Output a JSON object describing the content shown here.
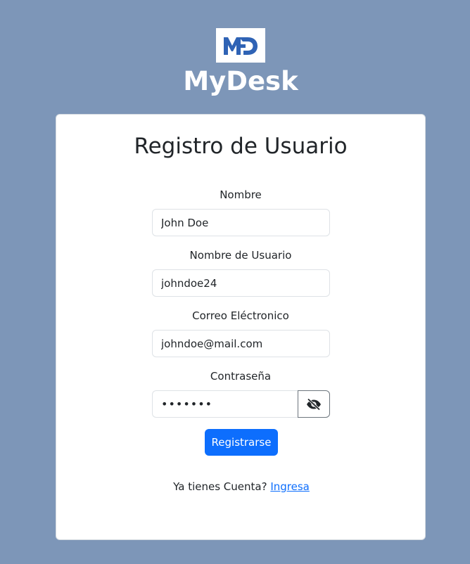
{
  "app": {
    "logo_text": "MD",
    "title": "MyDesk"
  },
  "form": {
    "title": "Registro de Usuario",
    "fields": [
      {
        "label": "Nombre",
        "value": "John Doe"
      },
      {
        "label": "Nombre de Usuario",
        "value": "johndoe24"
      },
      {
        "label": "Correo Eléctronico",
        "value": "johndoe@mail.com"
      },
      {
        "label": "Contraseña",
        "value": "•••••••"
      }
    ],
    "password_toggle_icon": "eye-slash-icon",
    "submit_label": "Registrarse",
    "footer_text": "Ya tienes Cuenta?",
    "footer_link_text": "Ingresa"
  },
  "colors": {
    "background": "#7d96b8",
    "primary": "#0d6efd",
    "logo_blue": "#2f63b5"
  }
}
